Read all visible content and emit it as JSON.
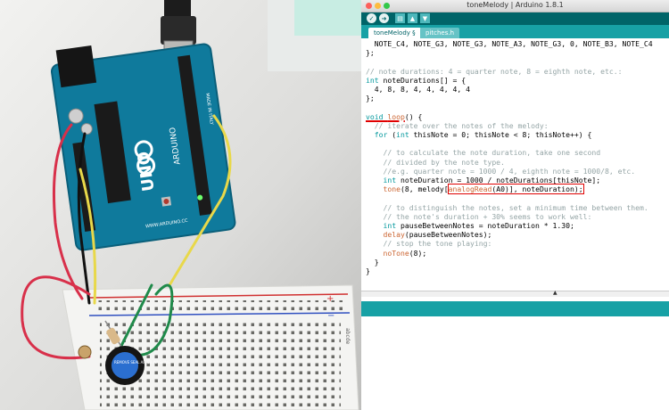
{
  "window": {
    "title": "toneMelody | Arduino 1.8.1"
  },
  "toolbar": {
    "buttons": [
      "verify-icon",
      "upload-icon",
      "new-icon",
      "open-icon",
      "save-icon"
    ]
  },
  "tabs": [
    {
      "label": "toneMelody §",
      "active": true
    },
    {
      "label": "pitches.h",
      "active": false
    }
  ],
  "code": {
    "l1": "  NOTE_C4, NOTE_G3, NOTE_G3, NOTE_A3, NOTE_G3, 0, NOTE_B3, NOTE_C4",
    "l2": "};",
    "l3": "",
    "l4": "// note durations: 4 = quarter note, 8 = eighth note, etc.:",
    "l5a": "int",
    "l5b": " noteDurations[] = {",
    "l6": "  4, 8, 8, 4, 4, 4, 4, 4",
    "l7": "};",
    "l8": "",
    "l9a": "void",
    "l9b": " ",
    "l9c": "loop",
    "l9d": "() {",
    "l10": "  // iterate over the notes of the melody:",
    "l11a": "  ",
    "l11b": "for",
    "l11c": " (",
    "l11d": "int",
    "l11e": " thisNote = 0; thisNote < 8; thisNote++) {",
    "l12": "",
    "l13": "    // to calculate the note duration, take one second",
    "l14": "    // divided by the note type.",
    "l15": "    //e.g. quarter note = 1000 / 4, eighth note = 1000/8, etc.",
    "l16a": "    ",
    "l16b": "int",
    "l16c": " noteDuration = 1000 / noteDurations[thisNote];",
    "l17a": "    ",
    "l17b": "tone",
    "l17c": "(8, melody[",
    "l17d": "analogRead",
    "l17e": "(A0)], noteDuration);",
    "l18": "",
    "l19": "    // to distinguish the notes, set a minimum time between them.",
    "l20": "    // the note's duration + 30% seems to work well:",
    "l21a": "    ",
    "l21b": "int",
    "l21c": " pauseBetweenNotes = noteDuration * 1.30;",
    "l22a": "    ",
    "l22b": "delay",
    "l22c": "(pauseBetweenNotes);",
    "l23": "    // stop the tone playing:",
    "l24a": "    ",
    "l24b": "noTone",
    "l24c": "(8);",
    "l25": "  }",
    "l26": "}"
  },
  "photo": {
    "board_logo": "UNO",
    "board_brand": "ARDUINO",
    "board_url": "WWW.ARDUINO.CC",
    "board_origin": "MADE IN ITALY",
    "breadboard_rail_labels": [
      "+",
      "−"
    ],
    "breadboard_row_labels": "abcde",
    "buzzer_text": "REMOVE SEAL AFTER WASHING"
  },
  "colors": {
    "arduino_teal_dark": "#006468",
    "arduino_teal": "#17a1a5",
    "keyword": "#00979c",
    "function": "#cc6633",
    "comment": "#95a5a6",
    "annotation_red": "#e00000"
  }
}
